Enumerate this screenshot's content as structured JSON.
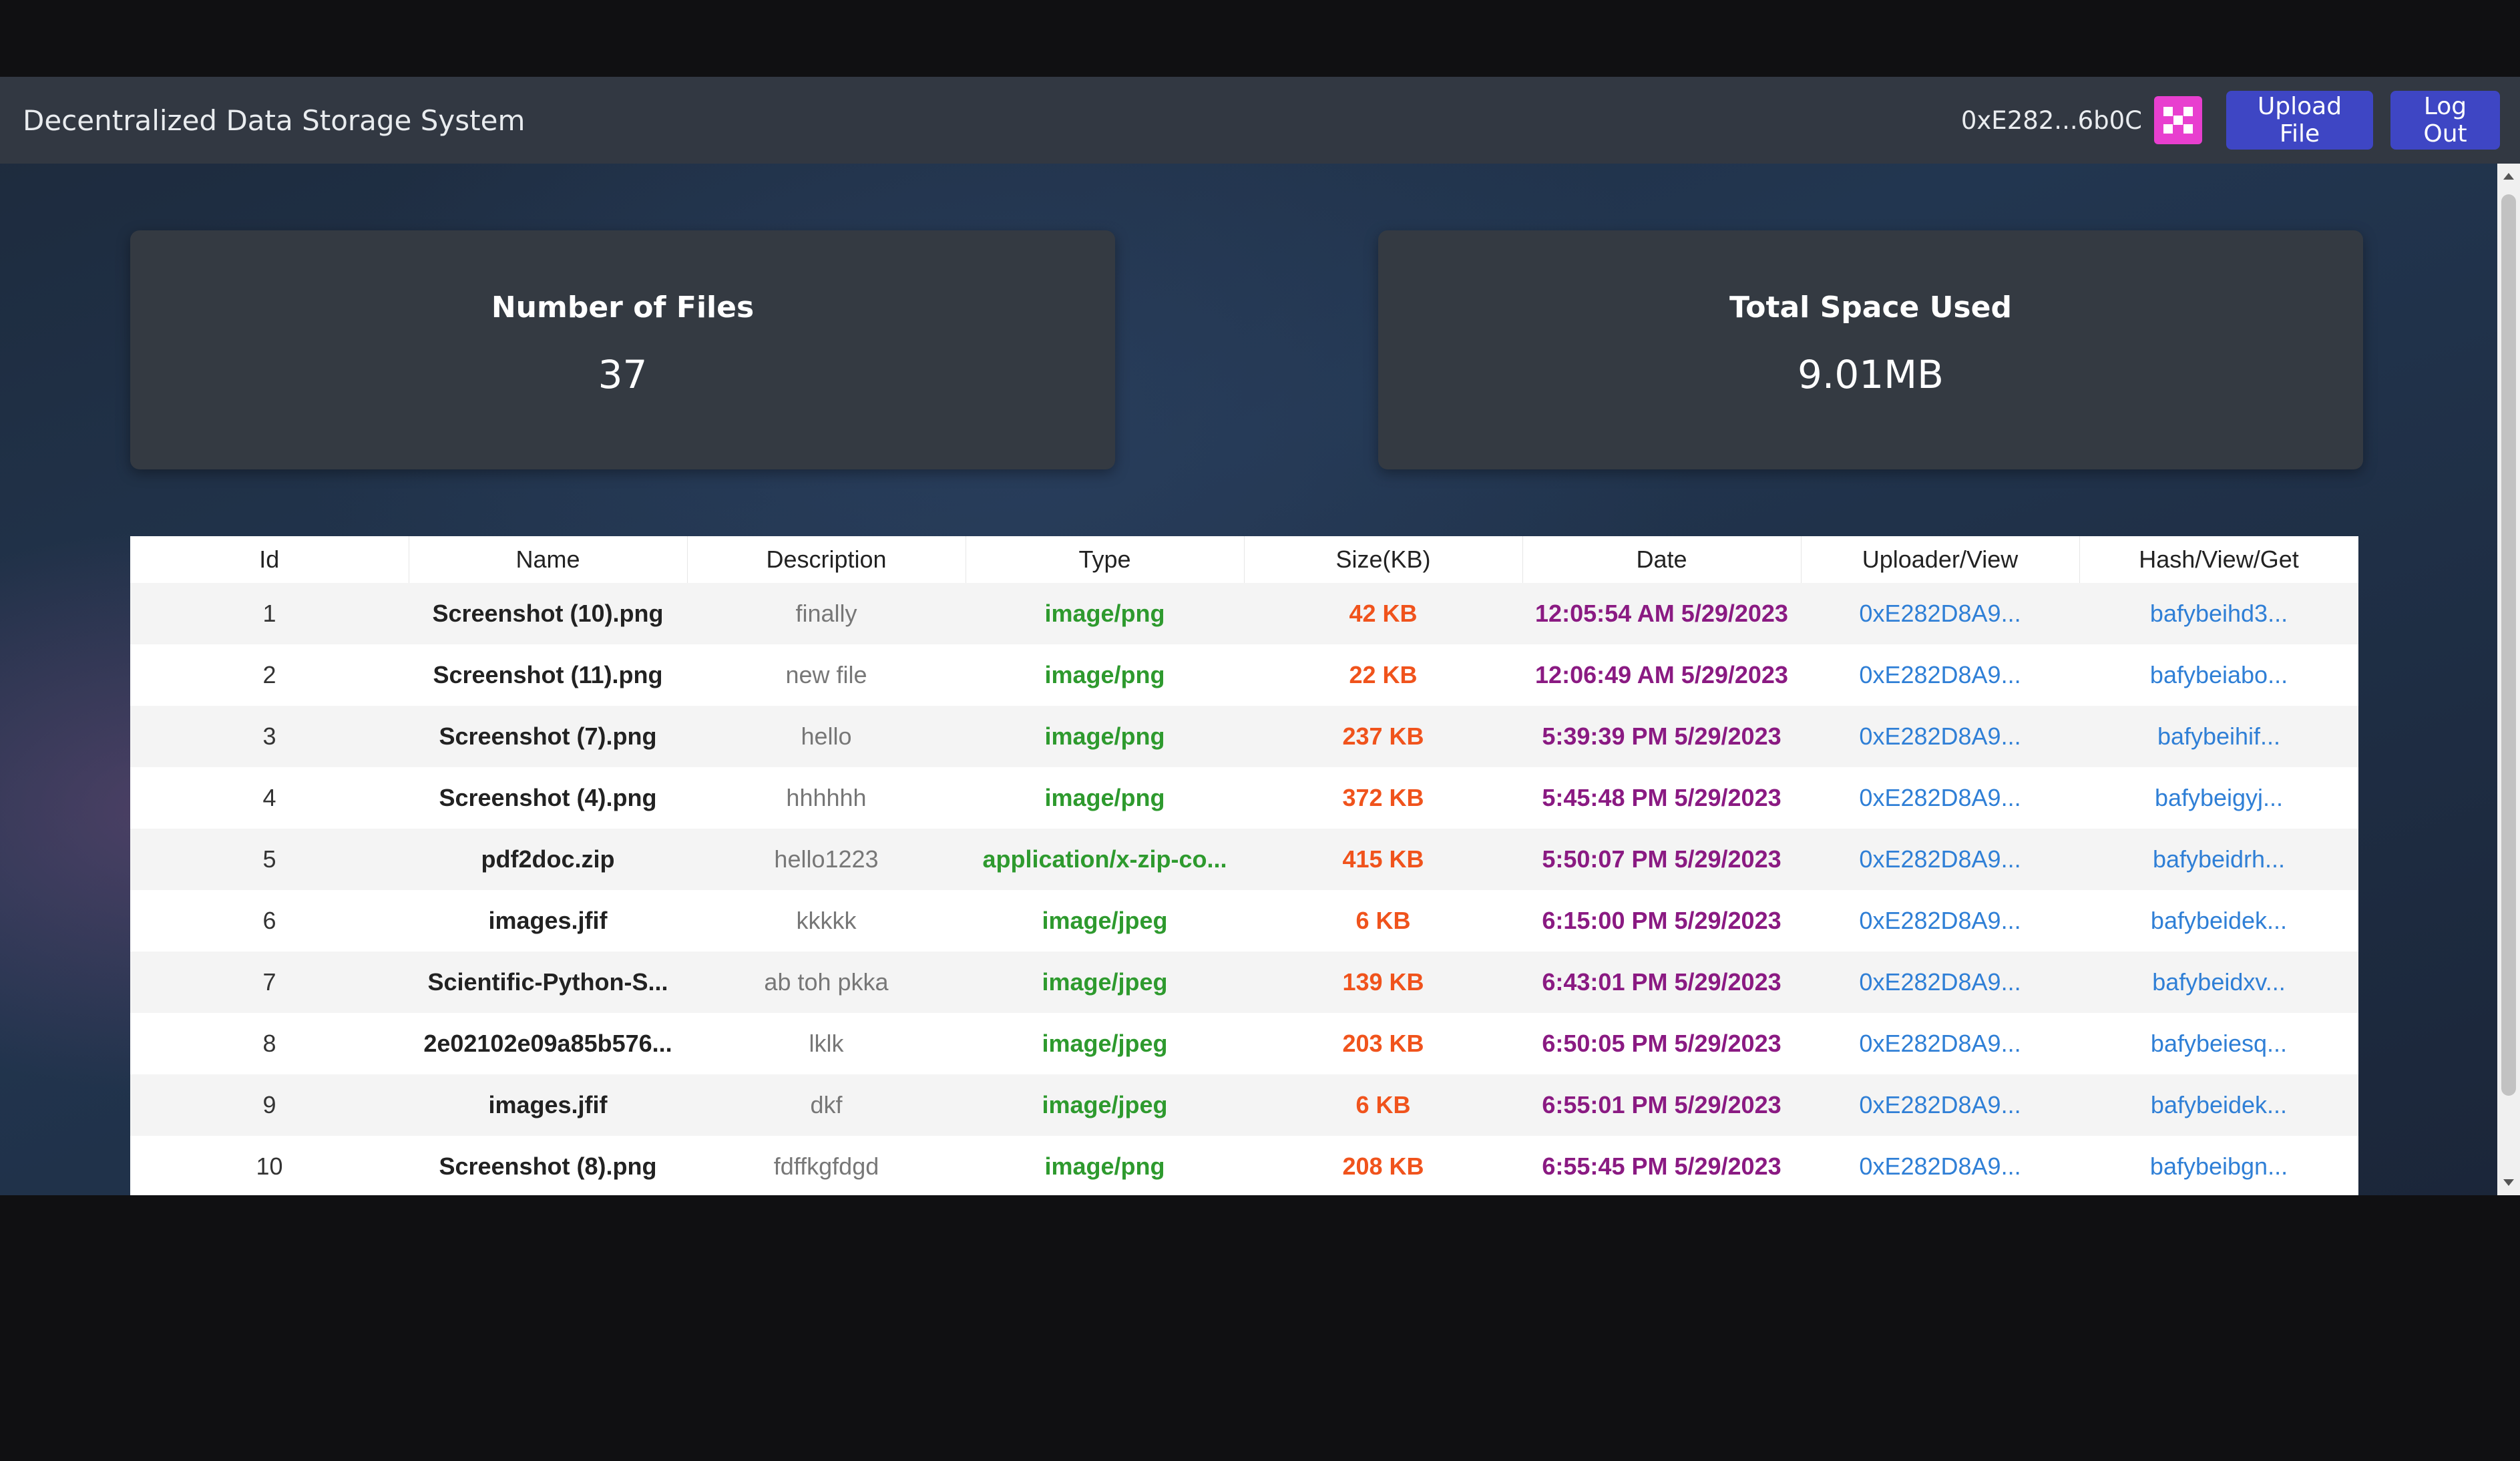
{
  "app": {
    "title": "Decentralized Data Storage System"
  },
  "navbar": {
    "account": "0xE282...6b0C",
    "avatar_icon": "identicon-avatar",
    "upload_label": "Upload File",
    "logout_label": "Log Out"
  },
  "stats": {
    "files_label": "Number of Files",
    "files_value": "37",
    "space_label": "Total Space Used",
    "space_value": "9.01MB"
  },
  "table": {
    "headers": [
      "Id",
      "Name",
      "Description",
      "Type",
      "Size(KB)",
      "Date",
      "Uploader/View",
      "Hash/View/Get"
    ],
    "rows": [
      {
        "id": "1",
        "name": "Screenshot (10).png",
        "desc": "finally",
        "type": "image/png",
        "size": "42 KB",
        "date": "12:05:54 AM 5/29/2023",
        "uploader": "0xE282D8A9...",
        "hash": "bafybeihd3..."
      },
      {
        "id": "2",
        "name": "Screenshot (11).png",
        "desc": "new file",
        "type": "image/png",
        "size": "22 KB",
        "date": "12:06:49 AM 5/29/2023",
        "uploader": "0xE282D8A9...",
        "hash": "bafybeiabo..."
      },
      {
        "id": "3",
        "name": "Screenshot (7).png",
        "desc": "hello",
        "type": "image/png",
        "size": "237 KB",
        "date": "5:39:39 PM 5/29/2023",
        "uploader": "0xE282D8A9...",
        "hash": "bafybeihif..."
      },
      {
        "id": "4",
        "name": "Screenshot (4).png",
        "desc": "hhhhhh",
        "type": "image/png",
        "size": "372 KB",
        "date": "5:45:48 PM 5/29/2023",
        "uploader": "0xE282D8A9...",
        "hash": "bafybeigyj..."
      },
      {
        "id": "5",
        "name": "pdf2doc.zip",
        "desc": "hello1223",
        "type": "application/x-zip-co...",
        "size": "415 KB",
        "date": "5:50:07 PM 5/29/2023",
        "uploader": "0xE282D8A9...",
        "hash": "bafybeidrh..."
      },
      {
        "id": "6",
        "name": "images.jfif",
        "desc": "kkkkk",
        "type": "image/jpeg",
        "size": "6 KB",
        "date": "6:15:00 PM 5/29/2023",
        "uploader": "0xE282D8A9...",
        "hash": "bafybeidek..."
      },
      {
        "id": "7",
        "name": "Scientific-Python-S...",
        "desc": "ab toh pkka",
        "type": "image/jpeg",
        "size": "139 KB",
        "date": "6:43:01 PM 5/29/2023",
        "uploader": "0xE282D8A9...",
        "hash": "bafybeidxv..."
      },
      {
        "id": "8",
        "name": "2e02102e09a85b576...",
        "desc": "lklk",
        "type": "image/jpeg",
        "size": "203 KB",
        "date": "6:50:05 PM 5/29/2023",
        "uploader": "0xE282D8A9...",
        "hash": "bafybeiesq..."
      },
      {
        "id": "9",
        "name": "images.jfif",
        "desc": "dkf",
        "type": "image/jpeg",
        "size": "6 KB",
        "date": "6:55:01 PM 5/29/2023",
        "uploader": "0xE282D8A9...",
        "hash": "bafybeidek..."
      },
      {
        "id": "10",
        "name": "Screenshot (8).png",
        "desc": "fdffkgfdgd",
        "type": "image/png",
        "size": "208 KB",
        "date": "6:55:45 PM 5/29/2023",
        "uploader": "0xE282D8A9...",
        "hash": "bafybeibgn..."
      }
    ]
  },
  "colors": {
    "navbar_bg": "#323842",
    "button_bg": "#3e46c4",
    "avatar": "#e83fcf",
    "type_text": "#2e9a2e",
    "size_text": "#f0531c",
    "date_text": "#8a1a82",
    "link_text": "#2f7fd6"
  }
}
